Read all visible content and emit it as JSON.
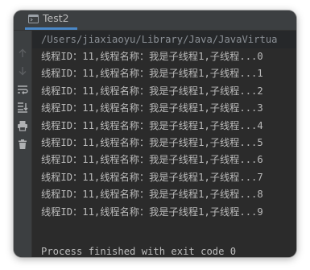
{
  "tab": {
    "label": "Test2",
    "icon": "run-console-icon"
  },
  "toolbar": {
    "icons": [
      "up-arrow-icon",
      "down-arrow-icon",
      "soft-wrap-icon",
      "scroll-to-end-icon",
      "print-icon",
      "trash-icon"
    ]
  },
  "console": {
    "path_line": "/Users/jiaxiaoyu/Library/Java/JavaVirtua",
    "output_lines": [
      "线程ID：11,线程名称：我是子线程1,子线程...0",
      "线程ID：11,线程名称：我是子线程1,子线程...1",
      "线程ID：11,线程名称：我是子线程1,子线程...2",
      "线程ID：11,线程名称：我是子线程1,子线程...3",
      "线程ID：11,线程名称：我是子线程1,子线程...4",
      "线程ID：11,线程名称：我是子线程1,子线程...5",
      "线程ID：11,线程名称：我是子线程1,子线程...6",
      "线程ID：11,线程名称：我是子线程1,子线程...7",
      "线程ID：11,线程名称：我是子线程1,子线程...8",
      "线程ID：11,线程名称：我是子线程1,子线程...9"
    ],
    "exit_message": "Process finished with exit code 0"
  },
  "colors": {
    "background": "#2b2b2b",
    "panel": "#3c3f41",
    "text": "#bbbbbb",
    "path_text": "#8a8f95",
    "tab_accent": "#4a88c7"
  }
}
